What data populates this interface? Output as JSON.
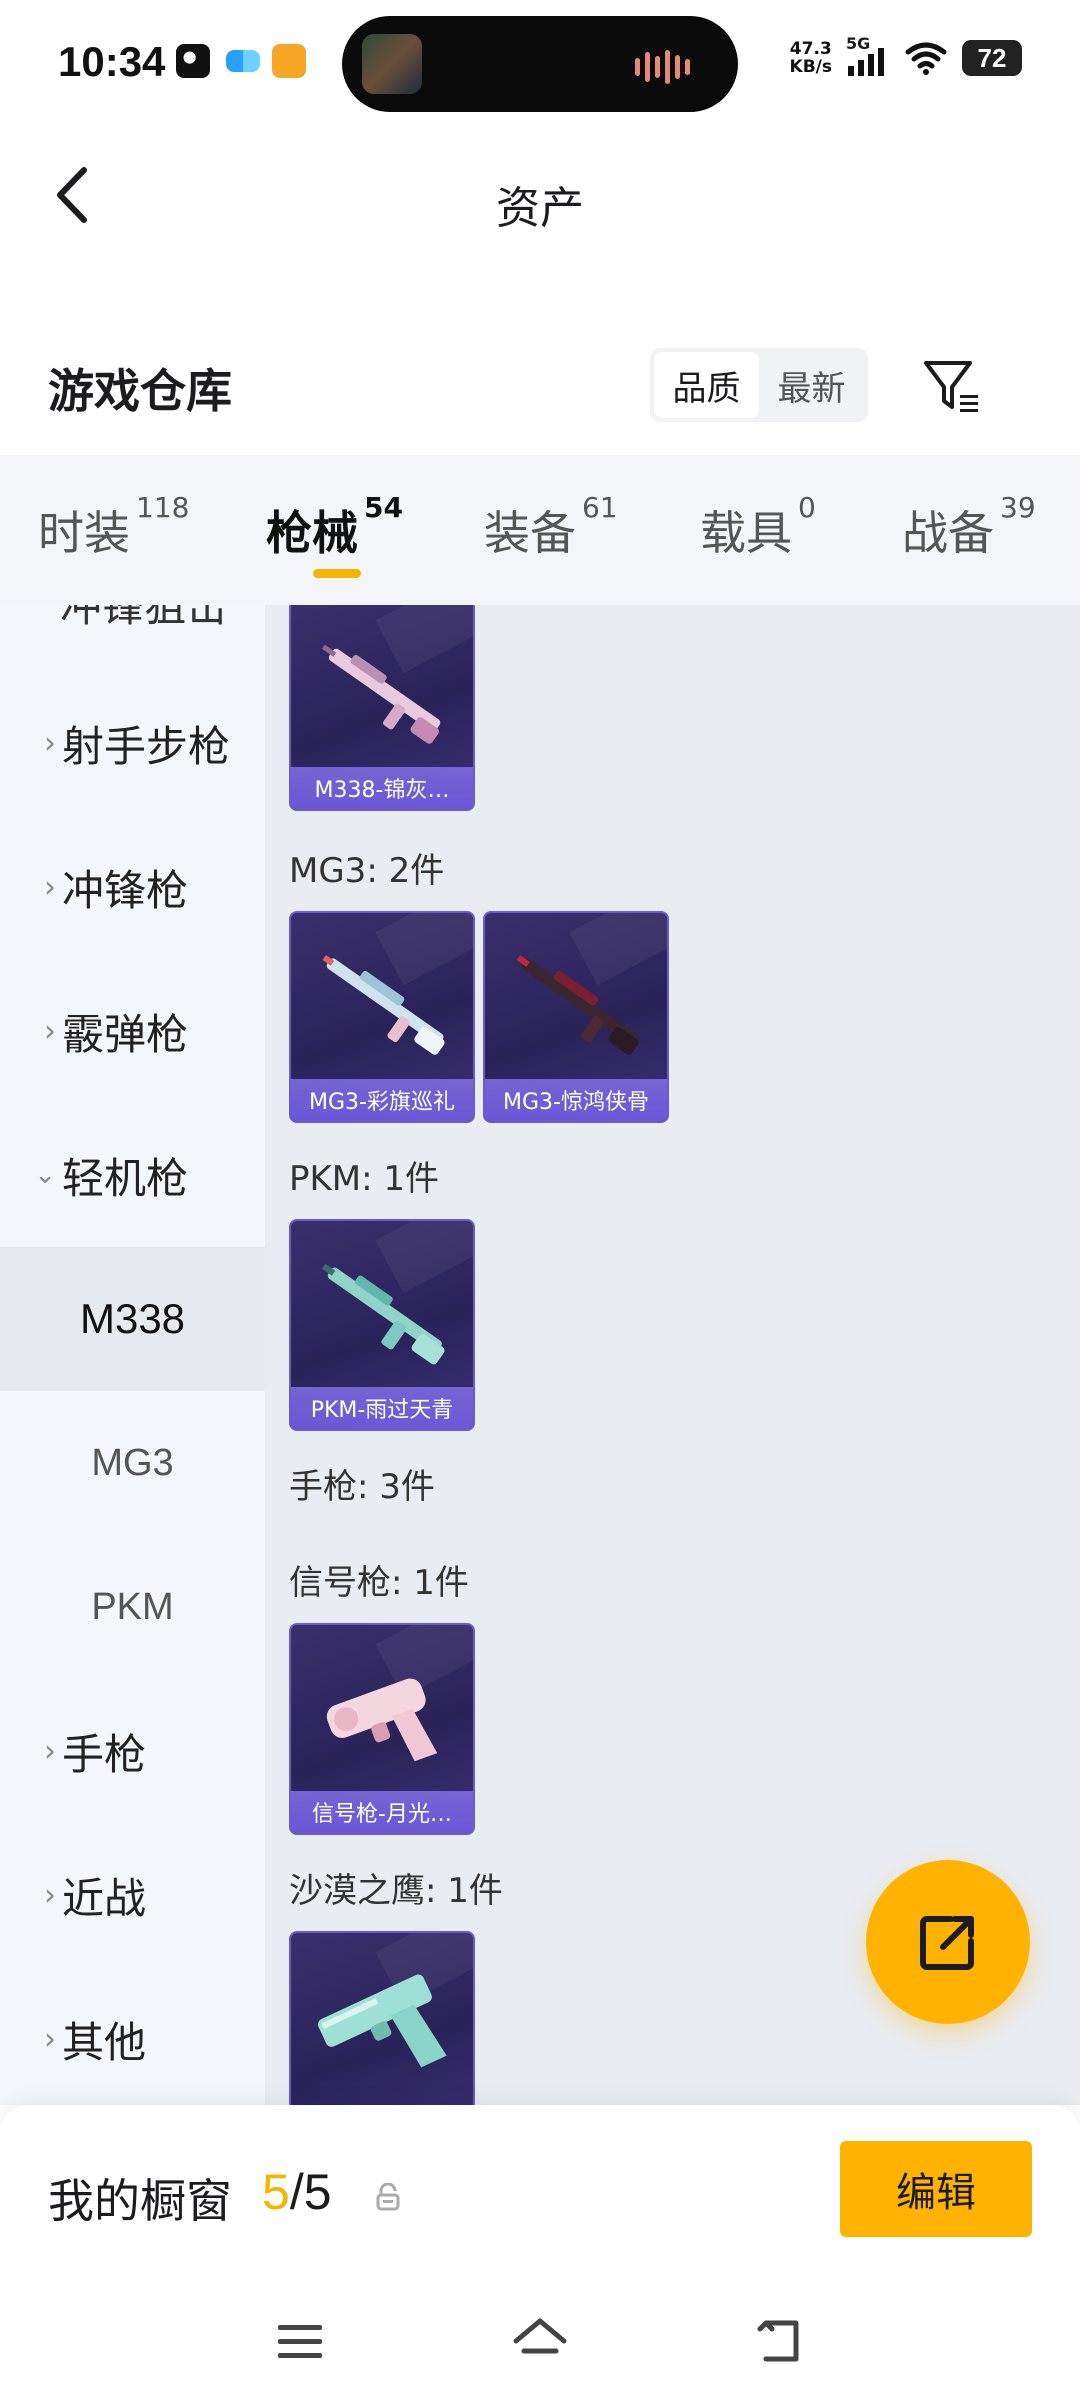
{
  "status_bar": {
    "time": "10:34",
    "net_speed_value": "47.3",
    "net_speed_unit": "KB/s",
    "network_type": "5G",
    "battery_level": "72"
  },
  "header": {
    "title": "资产"
  },
  "warehouse": {
    "title": "游戏仓库",
    "sort_options": [
      "品质",
      "最新"
    ],
    "sort_selected": "品质"
  },
  "tabs": [
    {
      "label": "时装",
      "count": "118"
    },
    {
      "label": "枪械",
      "count": "54"
    },
    {
      "label": "装备",
      "count": "61"
    },
    {
      "label": "载具",
      "count": "0"
    },
    {
      "label": "战备",
      "count": "39"
    }
  ],
  "active_tab": "枪械",
  "sidebar": {
    "cutoff_label": "冲锋狙击",
    "items": [
      {
        "label": "射手步枪",
        "expanded": false
      },
      {
        "label": "冲锋枪",
        "expanded": false
      },
      {
        "label": "霰弹枪",
        "expanded": false
      },
      {
        "label": "轻机枪",
        "expanded": true
      }
    ],
    "sub_items": [
      {
        "label": "M338",
        "selected": true
      },
      {
        "label": "MG3",
        "selected": false
      },
      {
        "label": "PKM",
        "selected": false
      }
    ],
    "items_after": [
      {
        "label": "手枪",
        "expanded": false
      },
      {
        "label": "近战",
        "expanded": false
      },
      {
        "label": "其他",
        "expanded": false
      }
    ]
  },
  "content": {
    "groups": [
      {
        "label": "",
        "items": [
          "M338-锦灰…"
        ]
      },
      {
        "label": "MG3: 2件",
        "items": [
          "MG3-彩旗巡礼",
          "MG3-惊鸿侠骨"
        ]
      },
      {
        "label": "PKM: 1件",
        "items": [
          "PKM-雨过天青"
        ]
      },
      {
        "label": "手枪: 3件",
        "items": []
      },
      {
        "label": "信号枪: 1件",
        "items": [
          "信号枪-月光…"
        ]
      },
      {
        "label": "沙漠之鹰: 1件",
        "items": [
          ""
        ]
      }
    ]
  },
  "showcase": {
    "label": "我的橱窗",
    "current": "5",
    "separator": "/",
    "total": "5"
  },
  "edit_button": {
    "label": "编辑"
  },
  "colors": {
    "accent": "#ffb300",
    "card_bg": "#2a2358",
    "card_border": "#6d5ad0",
    "sidebar_bg": "#f3f6fa",
    "content_bg": "#e9ecf1"
  },
  "icons": {
    "back": "chevron-left-icon",
    "filter": "filter-icon",
    "fab": "share-external-icon",
    "lock": "lock-icon",
    "nav_menu": "menu-icon",
    "nav_home": "home-icon",
    "nav_back": "return-icon"
  }
}
